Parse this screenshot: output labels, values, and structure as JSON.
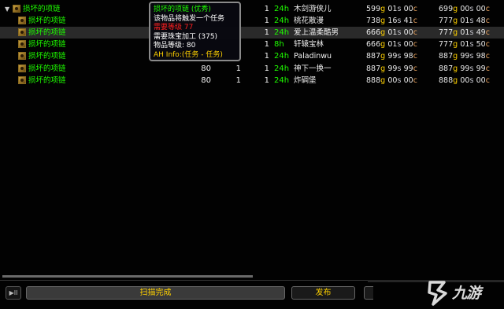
{
  "colors": {
    "item_name": "#1eff00",
    "gold": "#ffd100",
    "silver": "#c7c7cf",
    "copper": "#eda55f",
    "time": "#1eff00"
  },
  "rows": [
    {
      "name": "损坏的项链",
      "level": "",
      "qty": "",
      "bids": "1",
      "time": "24h",
      "seller": "木剑游侠儿",
      "bid_g": "599",
      "bid_s": "01",
      "bid_c": "00",
      "buy_g": "699",
      "buy_s": "00",
      "buy_c": "00",
      "group": true,
      "highlight": false
    },
    {
      "name": "损坏的项链",
      "level": "",
      "qty": "",
      "bids": "1",
      "time": "24h",
      "seller": "桃花散漫",
      "bid_g": "738",
      "bid_s": "16",
      "bid_c": "41",
      "buy_g": "777",
      "buy_s": "01",
      "buy_c": "48",
      "group": false,
      "highlight": false
    },
    {
      "name": "损坏的项链",
      "level": "",
      "qty": "",
      "bids": "1",
      "time": "24h",
      "seller": "爱上温柔酷男",
      "bid_g": "666",
      "bid_s": "01",
      "bid_c": "00",
      "buy_g": "777",
      "buy_s": "01",
      "buy_c": "49",
      "group": false,
      "highlight": true
    },
    {
      "name": "损坏的项链",
      "level": "",
      "qty": "",
      "bids": "1",
      "time": "8h",
      "seller": "轩辕宝林",
      "bid_g": "666",
      "bid_s": "01",
      "bid_c": "00",
      "buy_g": "777",
      "buy_s": "01",
      "buy_c": "50",
      "group": false,
      "highlight": false
    },
    {
      "name": "损坏的项链",
      "level": "",
      "qty": "",
      "bids": "1",
      "time": "24h",
      "seller": "Paladinwu",
      "bid_g": "887",
      "bid_s": "99",
      "bid_c": "98",
      "buy_g": "887",
      "buy_s": "99",
      "buy_c": "98",
      "group": false,
      "highlight": false
    },
    {
      "name": "损坏的项链",
      "level": "80",
      "qty": "1",
      "bids": "1",
      "time": "24h",
      "seller": "神下一换一",
      "bid_g": "887",
      "bid_s": "99",
      "bid_c": "99",
      "buy_g": "887",
      "buy_s": "99",
      "buy_c": "99",
      "group": false,
      "highlight": false
    },
    {
      "name": "损坏的项链",
      "level": "80",
      "qty": "1",
      "bids": "1",
      "time": "24h",
      "seller": "炸碉堡",
      "bid_g": "888",
      "bid_s": "00",
      "bid_c": "00",
      "buy_g": "888",
      "buy_s": "00",
      "buy_c": "00",
      "group": false,
      "highlight": false
    }
  ],
  "currency": {
    "g": "g",
    "s": "s",
    "c": "c"
  },
  "tooltip": {
    "title": "损坏的项链 (优秀)",
    "line1": "该物品将触发一个任务",
    "req_level": "需要等级 77",
    "req_skill": "需要珠宝加工 (375)",
    "item_level": "物品等级: 80",
    "ah_info": "AH Info:(任务 - 任务)"
  },
  "bottom": {
    "play_label": "▶II",
    "status": "扫描完成",
    "publish": "发布"
  },
  "watermark": {
    "text": "九游"
  }
}
